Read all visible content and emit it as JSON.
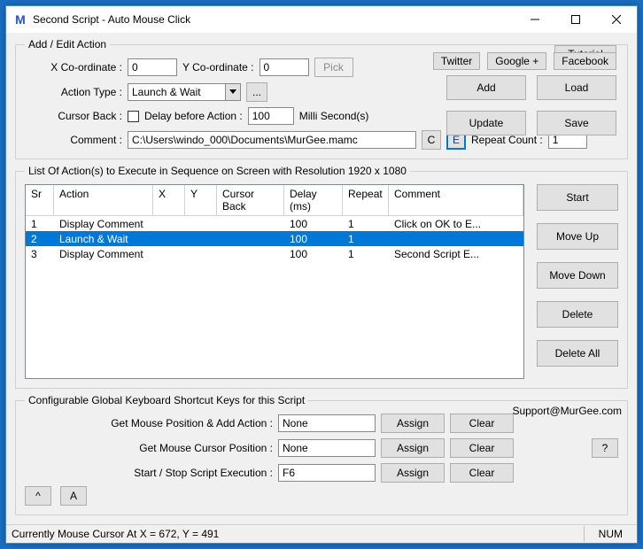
{
  "title": "Second Script - Auto Mouse Click",
  "toplinks": {
    "tutorial": "Tutorial",
    "twitter": "Twitter",
    "google": "Google +",
    "facebook": "Facebook"
  },
  "editgroup": {
    "legend": "Add / Edit Action",
    "xlabel": "X Co-ordinate :",
    "xvalue": "0",
    "ylabel": "Y Co-ordinate :",
    "yvalue": "0",
    "pick": "Pick",
    "actiontype_label": "Action Type :",
    "actiontype_value": "Launch & Wait",
    "dots": "...",
    "cursorback_label": "Cursor Back :",
    "delaybefore_label": "Delay before Action :",
    "delay_value": "100",
    "ms_label": "Milli Second(s)",
    "comment_label": "Comment :",
    "comment_value": "C:\\Users\\windo_000\\Documents\\MurGee.mamc",
    "C": "C",
    "E": "E",
    "repeat_label": "Repeat Count :",
    "repeat_value": "1"
  },
  "buttons": {
    "add": "Add",
    "load": "Load",
    "update": "Update",
    "save": "Save",
    "start": "Start",
    "moveup": "Move Up",
    "movedown": "Move Down",
    "delete": "Delete",
    "deleteall": "Delete All",
    "assign": "Assign",
    "clear": "Clear",
    "help": "?",
    "caret": "^",
    "A": "A"
  },
  "list": {
    "legend": "List Of Action(s) to Execute in Sequence on Screen with Resolution 1920 x 1080",
    "headers": {
      "sr": "Sr",
      "action": "Action",
      "x": "X",
      "y": "Y",
      "cb": "Cursor Back",
      "delay": "Delay (ms)",
      "repeat": "Repeat",
      "comment": "Comment"
    },
    "rows": [
      {
        "sr": "1",
        "action": "Display Comment",
        "x": "",
        "y": "",
        "cb": "",
        "delay": "100",
        "repeat": "1",
        "comment": "Click on OK to E...",
        "selected": false
      },
      {
        "sr": "2",
        "action": "Launch & Wait",
        "x": "",
        "y": "",
        "cb": "",
        "delay": "100",
        "repeat": "1",
        "comment": "",
        "selected": true
      },
      {
        "sr": "3",
        "action": "Display Comment",
        "x": "",
        "y": "",
        "cb": "",
        "delay": "100",
        "repeat": "1",
        "comment": "Second Script E...",
        "selected": false
      }
    ]
  },
  "shortcuts": {
    "legend": "Configurable Global Keyboard Shortcut Keys for this Script",
    "support": "Support@MurGee.com",
    "row1_label": "Get Mouse Position & Add Action :",
    "row1_value": "None",
    "row2_label": "Get Mouse Cursor Position :",
    "row2_value": "None",
    "row3_label": "Start / Stop Script Execution :",
    "row3_value": "F6"
  },
  "status": {
    "cursor": "Currently Mouse Cursor At X = 672, Y = 491",
    "num": "NUM"
  }
}
